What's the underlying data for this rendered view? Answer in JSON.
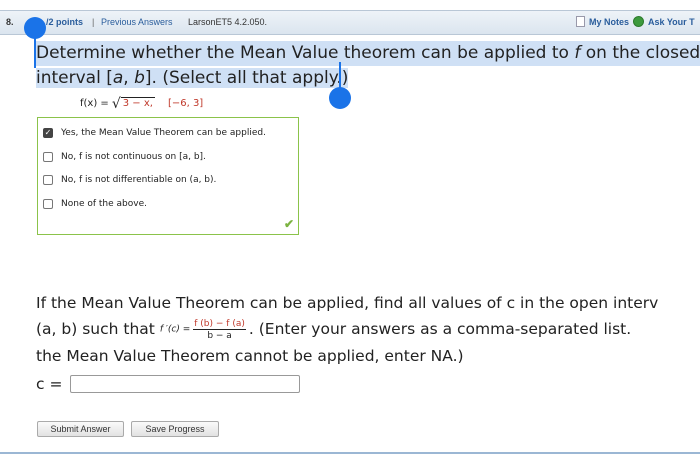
{
  "header": {
    "question_number": "8.",
    "points": "/2 points",
    "separator": "|",
    "previous_answers": "Previous Answers",
    "problem_code": "LarsonET5 4.2.050.",
    "my_notes": "My Notes",
    "ask_teacher": "Ask Your T"
  },
  "question": {
    "line1_start": "Determine whether the Mean Value theorem can be applied to ",
    "line1_var": "f",
    "line1_end": " on the closed",
    "line2_start": "interval [",
    "line2_a": "a",
    "line2_comma": ", ",
    "line2_b": "b",
    "line2_end": "]. (Select all that apply.)"
  },
  "formula": {
    "lhs": "f(x) =",
    "radicand": "3 − x,",
    "interval": "[−6, 3]"
  },
  "choices": [
    {
      "label": "Yes, the Mean Value Theorem can be applied.",
      "checked": true
    },
    {
      "label": "No, f is not continuous on [a, b].",
      "checked": false
    },
    {
      "label": "No, f is not differentiable on (a, b).",
      "checked": false
    },
    {
      "label": "None of the above.",
      "checked": false
    }
  ],
  "part2": {
    "line1": "If the Mean Value Theorem can be applied, find all values of c in the open interv",
    "line2_start": "(a, b) such that",
    "fprime": "f ′(c) =",
    "frac_num": "f (b) − f (a)",
    "frac_den": "b − a",
    "line2_end": ". (Enter your answers as a comma-separated list.",
    "line3": "the Mean Value Theorem cannot be applied, enter NA.)"
  },
  "answer": {
    "label": "c =",
    "value": ""
  },
  "buttons": {
    "submit": "Submit Answer",
    "save": "Save Progress"
  },
  "colors": {
    "accent": "#1a73e8",
    "correct": "#7cb342",
    "highlight": "#cfe0f5",
    "link": "#2a5d9c"
  }
}
